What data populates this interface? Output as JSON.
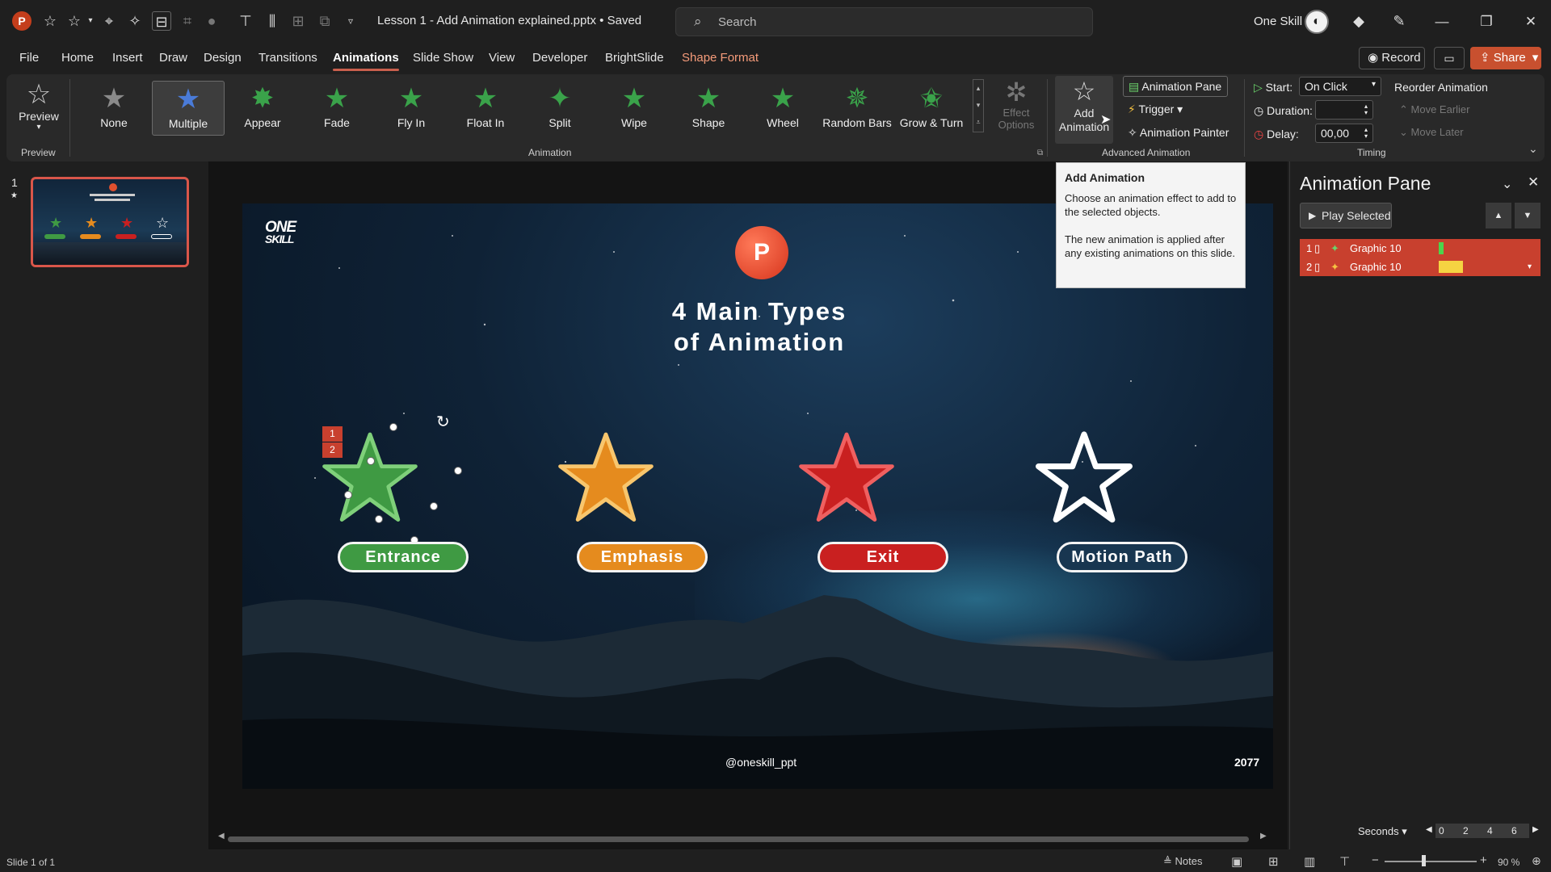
{
  "titlebar": {
    "app_icon": "P",
    "doc_title": "Lesson 1 - Add Animation explained.pptx • Saved",
    "search_placeholder": "Search",
    "user_name": "One Skill"
  },
  "menu": {
    "items": [
      "File",
      "Home",
      "Insert",
      "Draw",
      "Design",
      "Transitions",
      "Animations",
      "Slide Show",
      "View",
      "Developer",
      "BrightSlide",
      "Shape Format"
    ],
    "record": "Record",
    "share": "Share"
  },
  "ribbon": {
    "preview": "Preview",
    "preview_group": "Preview",
    "animation_group": "Animation",
    "advanced_group": "Advanced Animation",
    "timing_group": "Timing",
    "gallery": [
      "None",
      "Multiple",
      "Appear",
      "Fade",
      "Fly In",
      "Float In",
      "Split",
      "Wipe",
      "Shape",
      "Wheel",
      "Random Bars",
      "Grow & Turn"
    ],
    "effect_options": "Effect Options",
    "add_animation": "Add Animation",
    "animation_pane": "Animation Pane",
    "trigger": "Trigger",
    "animation_painter": "Animation Painter",
    "start_label": "Start:",
    "start_value": "On Click",
    "duration_label": "Duration:",
    "duration_value": "",
    "delay_label": "Delay:",
    "delay_value": "00,00",
    "reorder": "Reorder Animation",
    "move_earlier": "Move Earlier",
    "move_later": "Move Later"
  },
  "tooltip": {
    "title": "Add Animation",
    "line1": "Choose an animation effect to add to the selected objects.",
    "line2": "The new animation is applied after any existing animations on this slide."
  },
  "thumbnail": {
    "number": "1",
    "marker": "★"
  },
  "slide": {
    "logo_top": "ONE",
    "logo_bottom": "SKILL",
    "pp_icon": "P",
    "title_line1": "4 Main Types",
    "title_line2": "of Animation",
    "labels": [
      "Entrance",
      "Emphasis",
      "Exit",
      "Motion Path"
    ],
    "anim_numbers": [
      "1",
      "2"
    ],
    "handle": "@oneskill_ppt",
    "year": "2077"
  },
  "anim_pane": {
    "title": "Animation Pane",
    "play_selected": "Play Selected",
    "rows": [
      {
        "num": "1",
        "name": "Graphic 10"
      },
      {
        "num": "2",
        "name": "Graphic 10"
      }
    ],
    "seconds": "Seconds",
    "ticks": [
      "0",
      "2",
      "4",
      "6"
    ]
  },
  "status": {
    "slide_info": "Slide 1 of 1",
    "notes": "Notes",
    "zoom": "90 %"
  },
  "colors": {
    "accent": "#c8402e",
    "entrance": "#3f9a43",
    "emphasis": "#e58b1e",
    "exit": "#c92020"
  }
}
